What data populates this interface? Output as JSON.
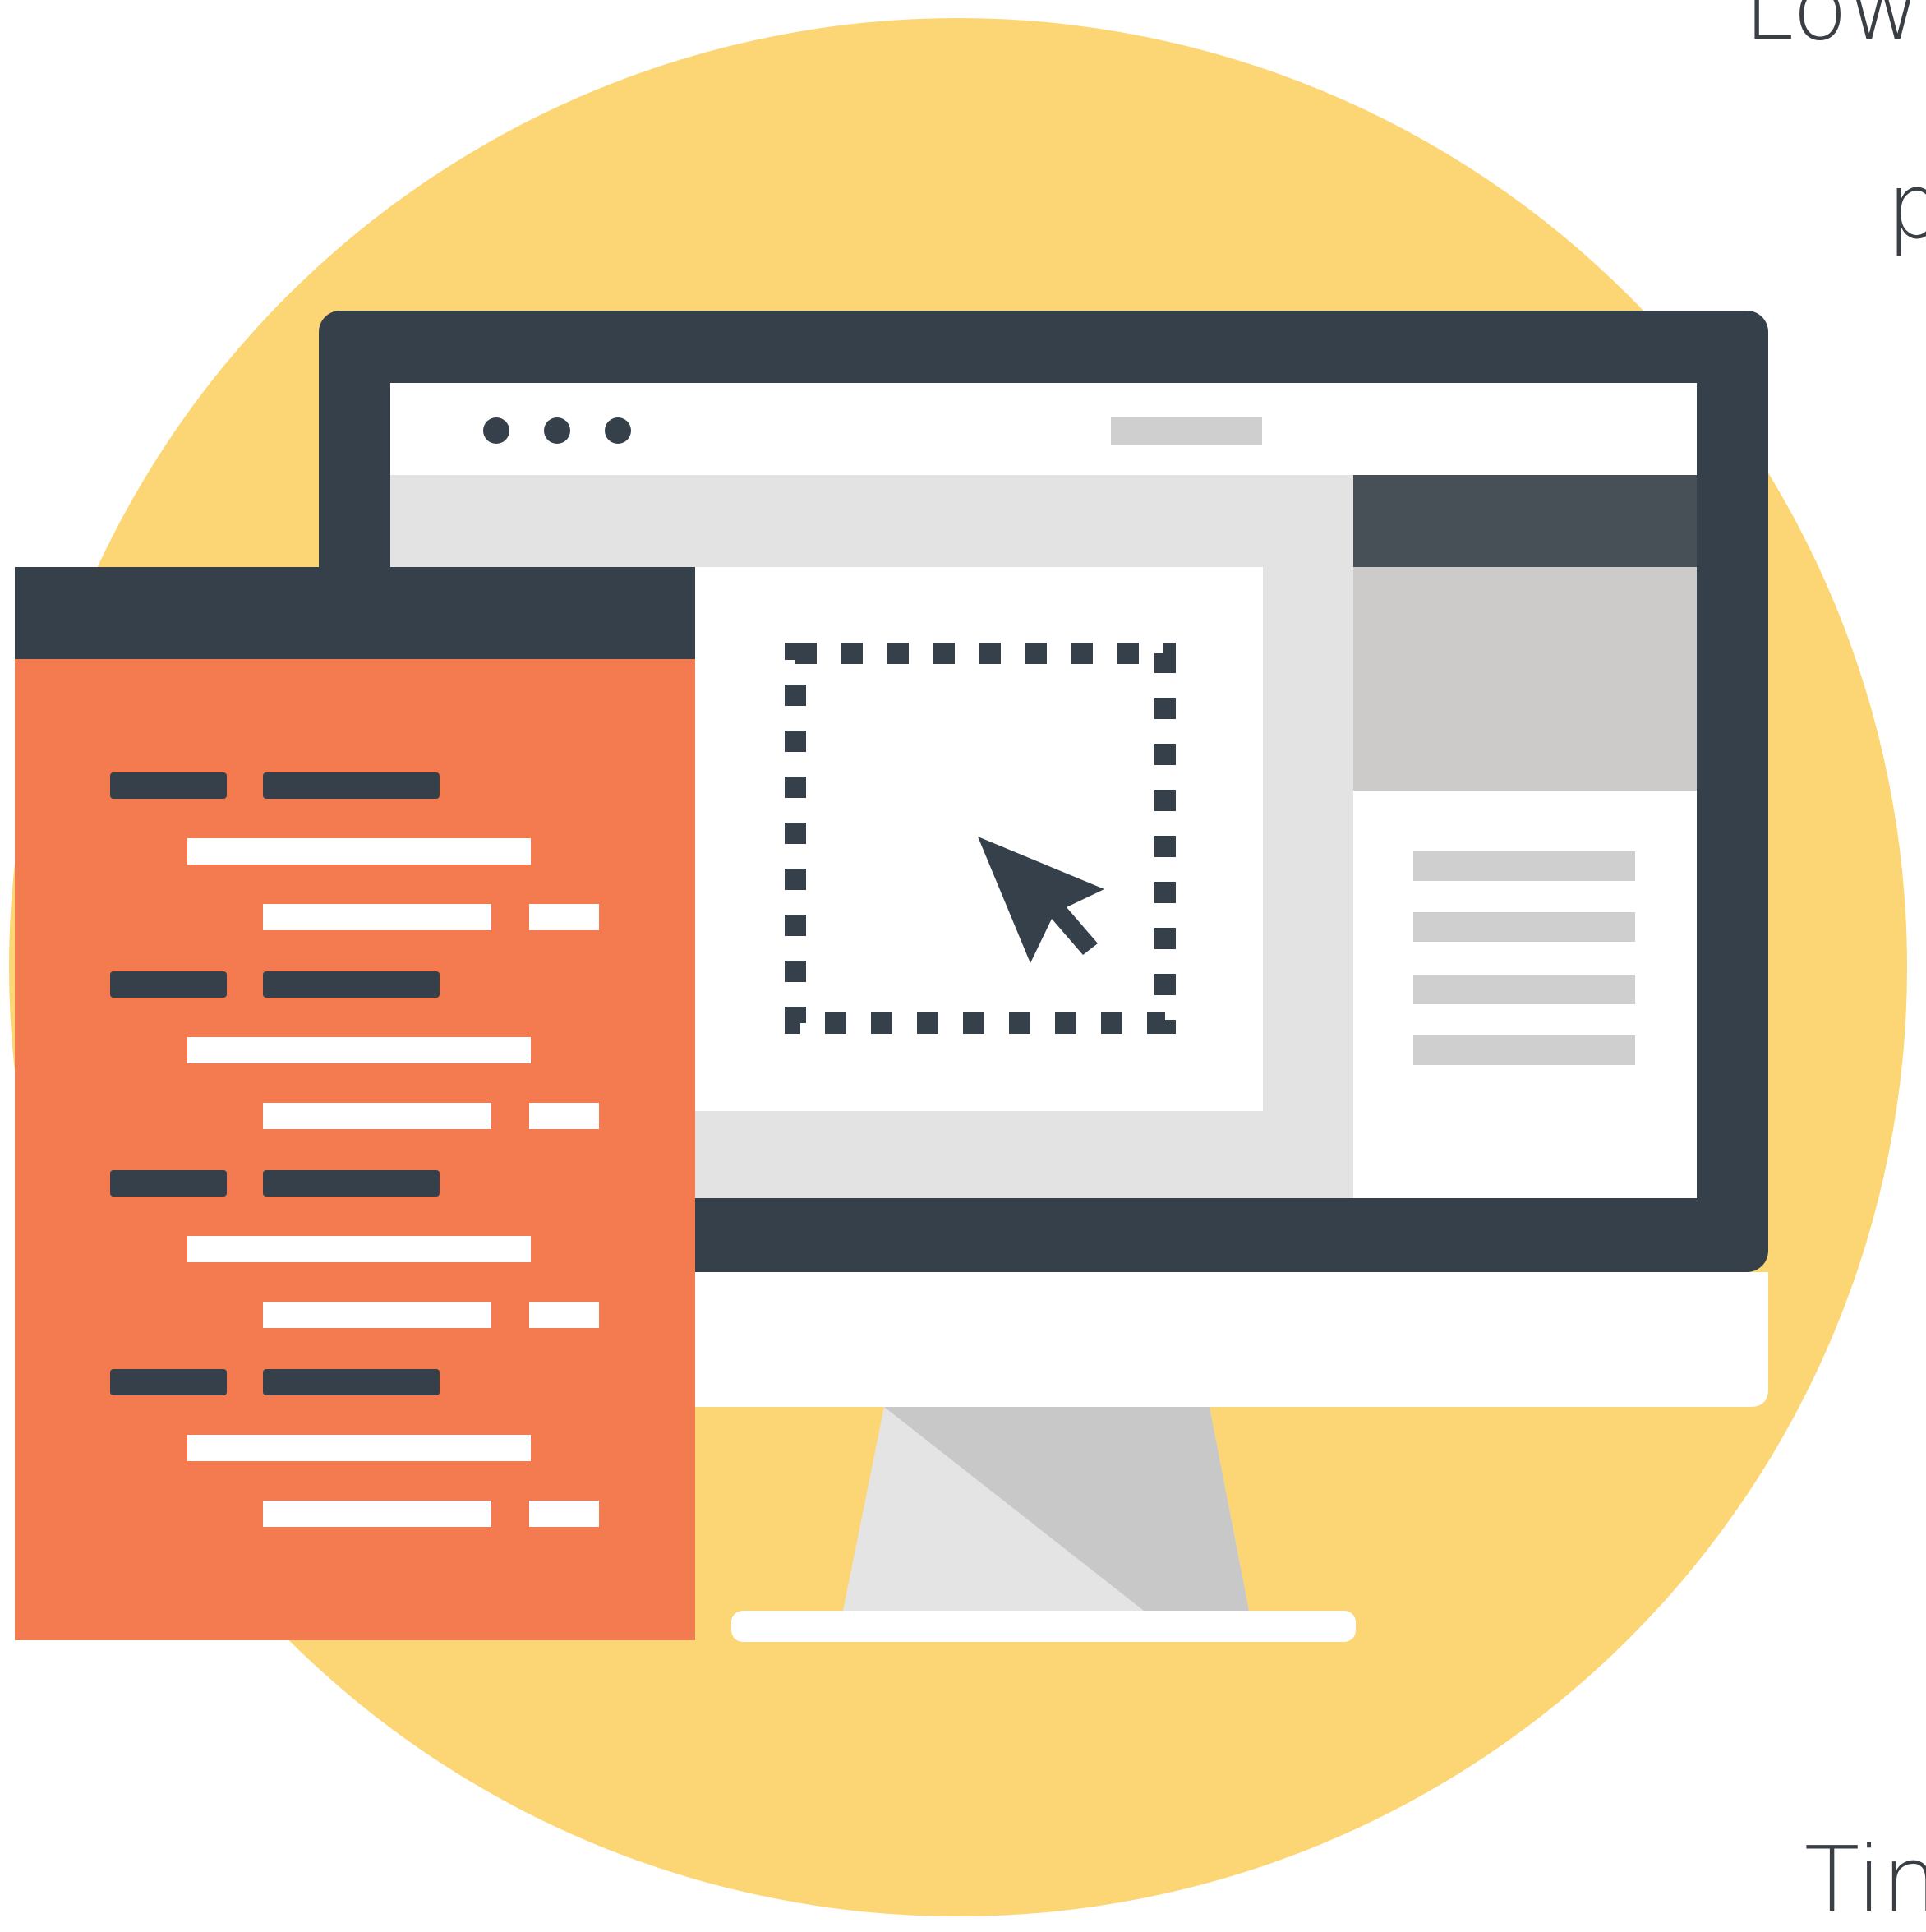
{
  "colors": {
    "background": "#ffffff",
    "circle": "#fcd675",
    "monitor_frame": "#36404a",
    "screen": "#ffffff",
    "canvas_light": "#e3e3e3",
    "sidebar_header": "#474f57",
    "sidebar_image": "#cdcbc9",
    "sidebar_lines": "#cfcfcf",
    "code_panel": "#f47a50",
    "code_header": "#36404a",
    "code_light": "#ffffff",
    "stand_light": "#e4e4e4",
    "stand_shadow": "#c8c8c8"
  },
  "icons": {
    "window_controls": "dots-icon",
    "cursor": "cursor-arrow-icon",
    "selection": "dotted-selection-icon"
  },
  "edge_text": {
    "top": "Low",
    "middle": "p",
    "bottom": "Tin"
  }
}
